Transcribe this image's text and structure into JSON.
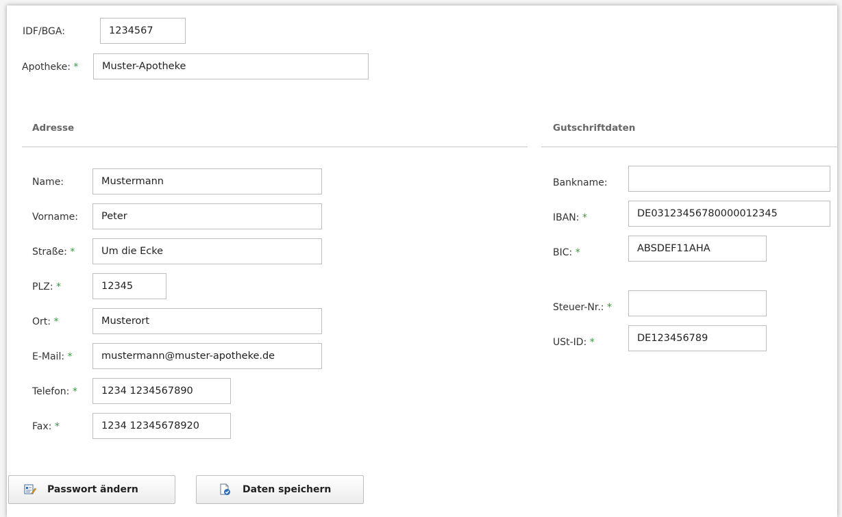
{
  "header_fields": {
    "idf_label": "IDF/BGA:",
    "idf_value": "1234567",
    "apotheke_label": "Apotheke:",
    "apotheke_value": "Muster-Apotheke"
  },
  "required_marker": "*",
  "adresse": {
    "title": "Adresse",
    "name_label": "Name:",
    "name_value": "Mustermann",
    "vorname_label": "Vorname:",
    "vorname_value": "Peter",
    "strasse_label": "Straße:",
    "strasse_value": "Um die Ecke",
    "plz_label": "PLZ:",
    "plz_value": "12345",
    "ort_label": "Ort:",
    "ort_value": "Musterort",
    "email_label": "E-Mail:",
    "email_value": "mustermann@muster-apotheke.de",
    "telefon_label": "Telefon:",
    "telefon_value": "1234 1234567890",
    "fax_label": "Fax:",
    "fax_value": "1234 12345678920"
  },
  "gutschrift": {
    "title": "Gutschriftdaten",
    "bankname_label": "Bankname:",
    "bankname_value": "",
    "iban_label": "IBAN:",
    "iban_value": "DE03123456780000012345",
    "bic_label": "BIC:",
    "bic_value": "ABSDEF11AHA",
    "steuer_label": "Steuer-Nr.:",
    "steuer_value": "",
    "ustid_label": "USt-ID:",
    "ustid_value": "DE123456789"
  },
  "buttons": {
    "passwort_label": "Passwort ändern",
    "passwort_icon": "edit-card-icon",
    "speichern_label": "Daten speichern",
    "speichern_icon": "save-document-icon"
  },
  "colors": {
    "required": "#2e9c3a",
    "section_title": "#666666",
    "icon_blue": "#2d6fb7"
  }
}
